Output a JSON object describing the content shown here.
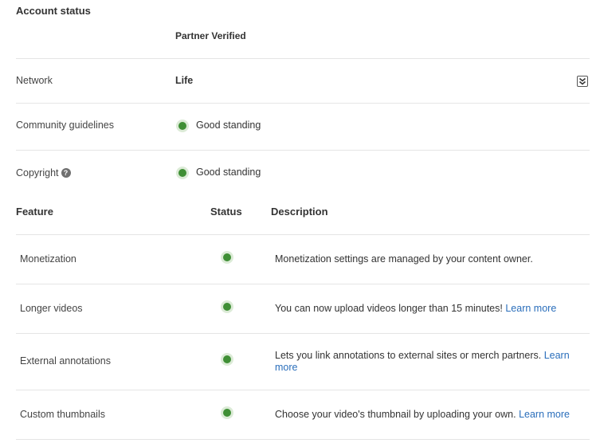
{
  "account": {
    "title": "Account status",
    "partner_status": "Partner Verified",
    "network": {
      "label": "Network",
      "value": "Life"
    },
    "community": {
      "label": "Community guidelines",
      "value": "Good standing"
    },
    "copyright": {
      "label": "Copyright",
      "value": "Good standing"
    }
  },
  "features_table": {
    "headers": {
      "feature": "Feature",
      "status": "Status",
      "description": "Description"
    },
    "rows": [
      {
        "feature": "Monetization",
        "description": "Monetization settings are managed by your content owner.",
        "link": ""
      },
      {
        "feature": "Longer videos",
        "description": "You can now upload videos longer than 15 minutes!",
        "link": "Learn more"
      },
      {
        "feature": "External annotations",
        "description": "Lets you link annotations to external sites or merch partners.",
        "link": "Learn more"
      },
      {
        "feature": "Custom thumbnails",
        "description": "Choose your video's thumbnail by uploading your own.",
        "link": "Learn more"
      }
    ]
  },
  "colors": {
    "status_green": "#3f8f35",
    "link": "#2a6ebb"
  },
  "icons": {
    "help": "question-circle-icon",
    "expand": "double-chevron-down-icon",
    "status": "green-dot-icon"
  },
  "help_glyph": "?"
}
